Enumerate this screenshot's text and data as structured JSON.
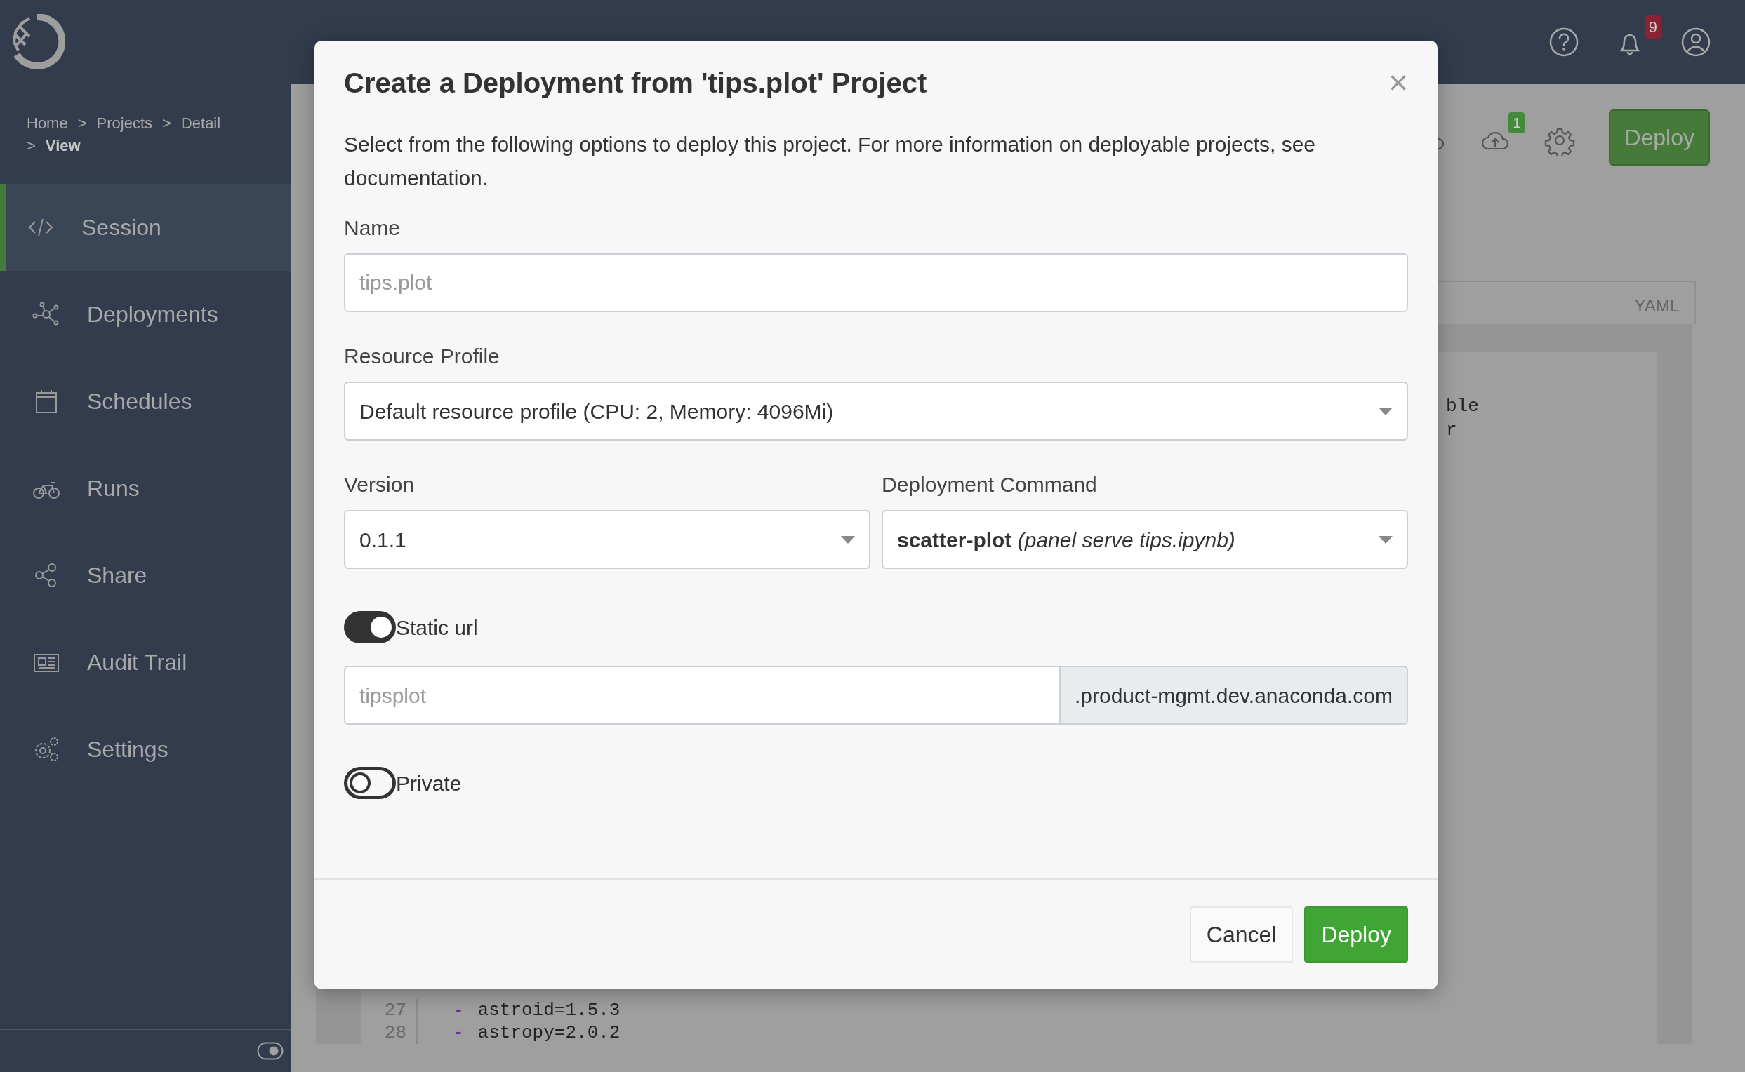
{
  "header": {
    "notifications_badge": "9"
  },
  "breadcrumb": [
    {
      "label": "Home",
      "current": false
    },
    {
      "separator": ">",
      "label": "Projects",
      "current": false
    },
    {
      "separator": ">",
      "label": "Detail",
      "current": false
    },
    {
      "separator": ">",
      "label": "View",
      "current": true
    }
  ],
  "sidebar": {
    "items": [
      {
        "label": "Session",
        "selected": true
      },
      {
        "label": "Deployments",
        "selected": false
      },
      {
        "label": "Schedules",
        "selected": false
      },
      {
        "label": "Runs",
        "selected": false
      },
      {
        "label": "Share",
        "selected": false
      },
      {
        "label": "Audit Trail",
        "selected": false
      },
      {
        "label": "Settings",
        "selected": false
      }
    ],
    "theme_toggle": {
      "on": true
    }
  },
  "toolbar": {
    "upload_badge": "1",
    "deploy_button": "Deploy"
  },
  "tabs": [
    {
      "label": "YAML"
    }
  ],
  "editor": {
    "fragments": [
      "ble",
      "r"
    ],
    "lines": [
      {
        "number": "27",
        "marker": "-",
        "code": "astroid=1.5.3"
      },
      {
        "number": "28",
        "marker": "-",
        "code": "astropy=2.0.2"
      }
    ]
  },
  "modal": {
    "title": "Create a Deployment from 'tips.plot' Project",
    "close": "×",
    "description": "Select from the following options to deploy this project. For more information on deployable projects, see documentation.",
    "name": {
      "label": "Name",
      "placeholder": "tips.plot"
    },
    "resource_profile": {
      "label": "Resource Profile",
      "value": "Default resource profile (CPU: 2, Memory: 4096Mi)"
    },
    "version": {
      "label": "Version",
      "value": "0.1.1"
    },
    "deployment_command": {
      "label": "Deployment Command",
      "value": "**scatter-plot** *(panel serve tips.ipynb)*"
    },
    "static_url": {
      "label": "Static url",
      "on": true,
      "placeholder": "tipsplot",
      "suffix": ".product-mgmt.dev.anaconda.com"
    },
    "private": {
      "label": "Private",
      "on": false
    },
    "buttons": [
      {
        "label": "Cancel",
        "kind": "secondary"
      },
      {
        "label": "Deploy",
        "kind": "primary"
      }
    ]
  }
}
